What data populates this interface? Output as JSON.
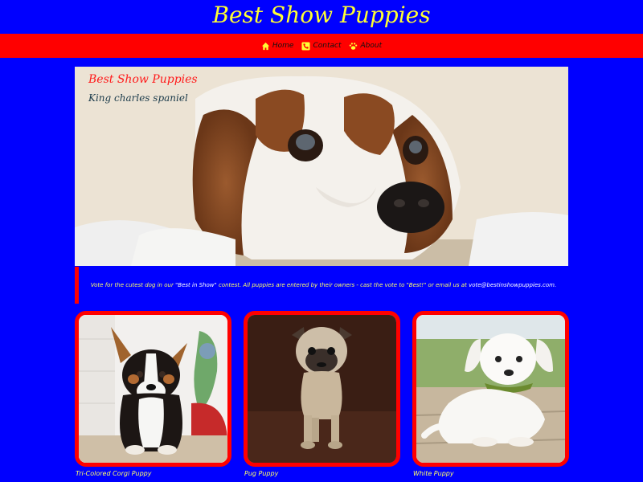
{
  "header": {
    "title": "Best Show Puppies"
  },
  "nav": {
    "items": [
      {
        "label": "Home",
        "icon": "home-icon"
      },
      {
        "label": "Contact",
        "icon": "phone-icon"
      },
      {
        "label": "About",
        "icon": "paw-icon"
      }
    ]
  },
  "hero": {
    "title": "Best Show Puppies",
    "subtitle": "King charles spaniel"
  },
  "intro": {
    "prefix": "Vote for the cutest dog in our",
    "highlight": "\"Best in Show\"",
    "middle": "contest. All puppies are entered by their owners - cast the vote to \"Best!\" or email us at",
    "email": "vote@bestinshowpuppies.com."
  },
  "gallery": {
    "cards": [
      {
        "caption": "Tri-Colored Corgi Puppy"
      },
      {
        "caption": "Pug Puppy"
      },
      {
        "caption": "White Puppy"
      }
    ]
  },
  "colors": {
    "background": "#0000ff",
    "accent": "#ff0000",
    "title": "#ffff33"
  }
}
